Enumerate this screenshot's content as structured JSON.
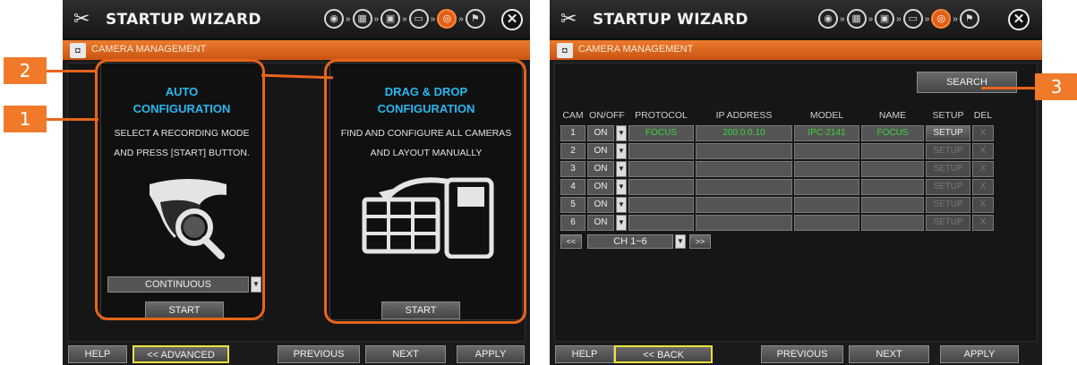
{
  "left": {
    "title": "STARTUP WIZARD",
    "section": "CAMERA MANAGEMENT",
    "auto": {
      "title_line1": "AUTO",
      "title_line2": "CONFIGURATION",
      "desc_line1": "SELECT A RECORDING MODE",
      "desc_line2": "AND PRESS [START] BUTTON.",
      "mode_value": "CONTINUOUS",
      "start_label": "START"
    },
    "dragdrop": {
      "title_line1": "DRAG & DROP",
      "title_line2": "CONFIGURATION",
      "desc_line1": "FIND AND CONFIGURE ALL CAMERAS",
      "desc_line2": "AND LAYOUT MANUALLY",
      "start_label": "START"
    },
    "footer": {
      "help": "HELP",
      "advanced": "<< ADVANCED",
      "previous": "PREVIOUS",
      "next": "NEXT",
      "apply": "APPLY"
    }
  },
  "right": {
    "title": "STARTUP WIZARD",
    "section": "CAMERA MANAGEMENT",
    "search_label": "SEARCH",
    "columns": [
      "CAM",
      "ON/OFF",
      "PROTOCOL",
      "IP ADDRESS",
      "MODEL",
      "NAME",
      "SETUP",
      "DEL"
    ],
    "rows": [
      {
        "cam": "1",
        "onoff": "ON",
        "protocol": "FOCUS",
        "ip": "200.0.0.10",
        "model": "IPC-2141",
        "name": "FOCUS",
        "setup": "SETUP",
        "del": "X"
      },
      {
        "cam": "2",
        "onoff": "ON",
        "protocol": "",
        "ip": "",
        "model": "",
        "name": "",
        "setup": "SETUP",
        "del": "X"
      },
      {
        "cam": "3",
        "onoff": "ON",
        "protocol": "",
        "ip": "",
        "model": "",
        "name": "",
        "setup": "SETUP",
        "del": "X"
      },
      {
        "cam": "4",
        "onoff": "ON",
        "protocol": "",
        "ip": "",
        "model": "",
        "name": "",
        "setup": "SETUP",
        "del": "X"
      },
      {
        "cam": "5",
        "onoff": "ON",
        "protocol": "",
        "ip": "",
        "model": "",
        "name": "",
        "setup": "SETUP",
        "del": "X"
      },
      {
        "cam": "6",
        "onoff": "ON",
        "protocol": "",
        "ip": "",
        "model": "",
        "name": "",
        "setup": "SETUP",
        "del": "X"
      }
    ],
    "pager": {
      "prev": "<<",
      "range": "CH 1~6",
      "next": ">>"
    },
    "footer": {
      "help": "HELP",
      "back": "<< BACK",
      "previous": "PREVIOUS",
      "next": "NEXT",
      "apply": "APPLY"
    }
  },
  "callouts": {
    "one": "1",
    "two": "2",
    "three": "3"
  },
  "colors": {
    "accent": "#e8641c",
    "title_blue": "#29b8f0",
    "status_green": "#3cd23c",
    "highlight_yellow": "#e9e23d"
  }
}
